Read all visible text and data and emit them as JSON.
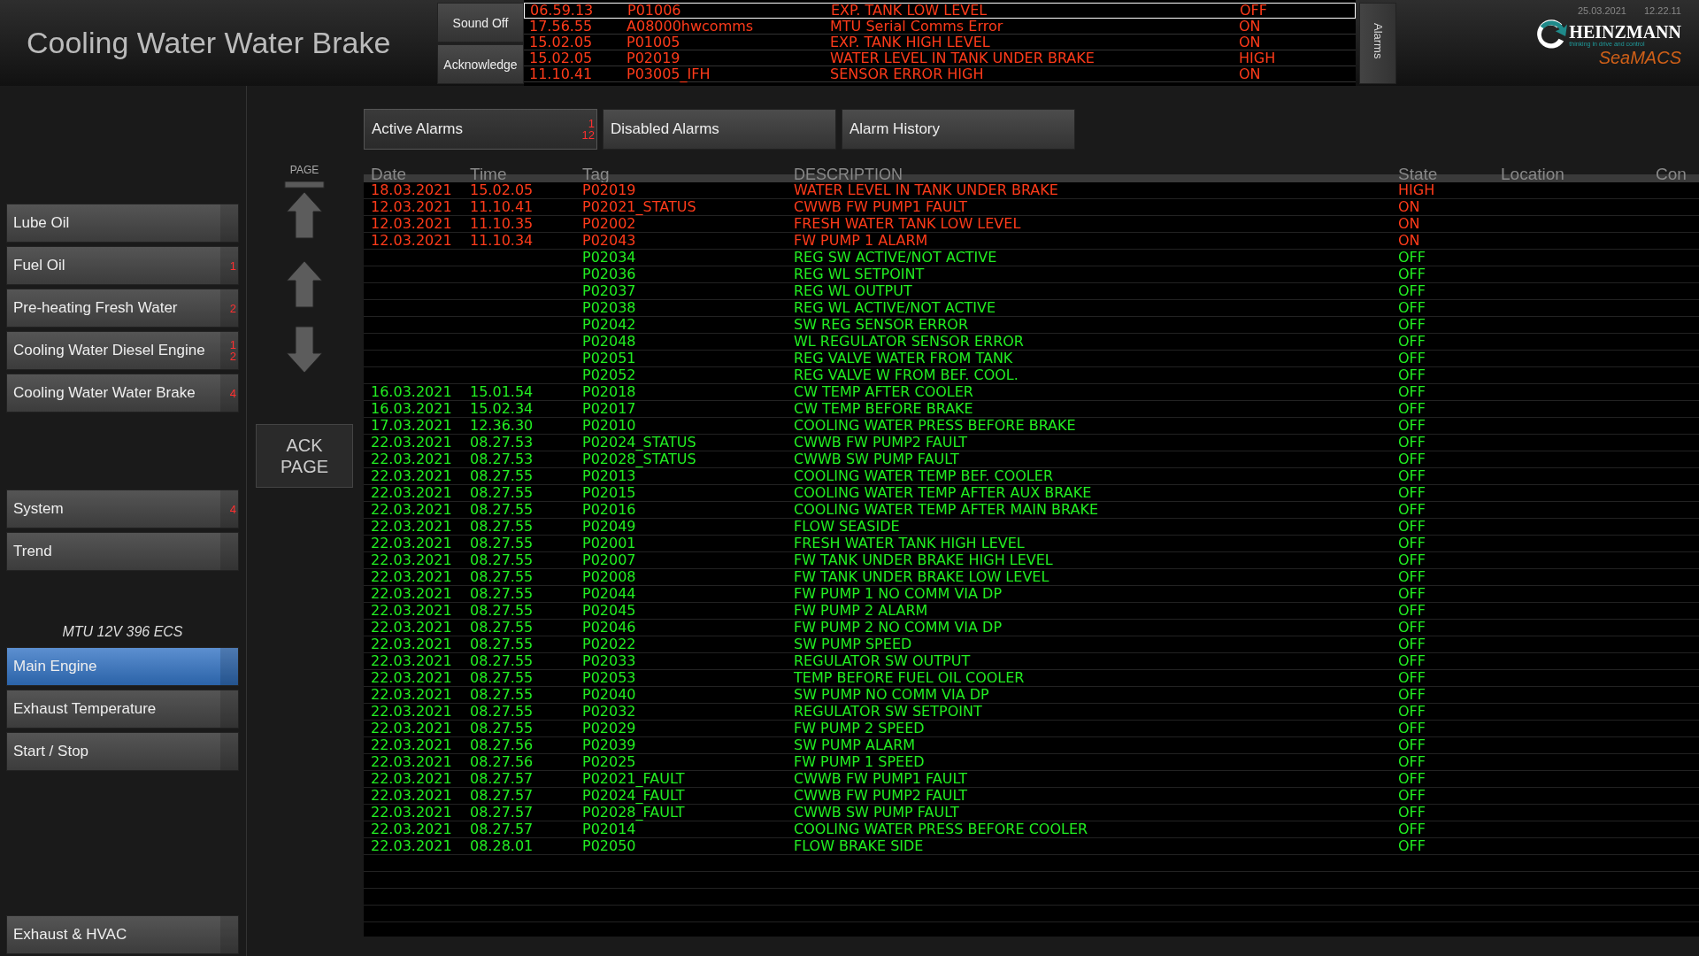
{
  "header": {
    "title": "Cooling Water Water Brake",
    "date": "25.03.2021",
    "time": "12.22.11"
  },
  "alarm_buttons": [
    "Sound Off",
    "Acknowledge"
  ],
  "alarm_banner": [
    {
      "time": "06.59.13",
      "tag": "P01006",
      "description": "EXP. TANK LOW LEVEL",
      "state": "OFF",
      "selected": true
    },
    {
      "time": "17.56.55",
      "tag": "A08000hwcomms",
      "description": "MTU Serial Comms Error",
      "state": "ON",
      "selected": false
    },
    {
      "time": "15.02.05",
      "tag": "P01005",
      "description": "EXP. TANK HIGH LEVEL",
      "state": "ON",
      "selected": false
    },
    {
      "time": "15.02.05",
      "tag": "P02019",
      "description": "WATER LEVEL IN TANK UNDER BRAKE",
      "state": "HIGH",
      "selected": false
    },
    {
      "time": "11.10.41",
      "tag": "P03005_IFH",
      "description": "SENSOR ERROR HIGH",
      "state": "ON",
      "selected": false
    }
  ],
  "alarms_tab": "Alarms",
  "logo": {
    "name": "HEINZMANN",
    "tagline": "thinking in drive and control",
    "product": "SeaMACS"
  },
  "sidebar": {
    "groups": [
      {
        "items": [
          {
            "label": "Lube Oil",
            "selected": false
          },
          {
            "label": "Fuel Oil",
            "badge": [
              "1"
            ],
            "selected": false
          },
          {
            "label": "Pre-heating Fresh Water",
            "badge": [
              "2"
            ],
            "selected": false
          },
          {
            "label": "Cooling Water Diesel Engine",
            "badge": [
              "1",
              "2"
            ],
            "selected": false
          },
          {
            "label": "Cooling Water Water Brake",
            "badge": [
              "4"
            ],
            "selected": false
          }
        ]
      },
      {
        "items": [
          {
            "label": "System",
            "badge": [
              "4"
            ],
            "selected": false
          },
          {
            "label": "Trend",
            "selected": false
          }
        ]
      },
      {
        "heading": "MTU 12V 396 ECS",
        "items": [
          {
            "label": "Main Engine",
            "selected": true
          },
          {
            "label": "Exhaust Temperature",
            "selected": false
          },
          {
            "label": "Start / Stop",
            "selected": false
          }
        ]
      },
      {
        "items": [
          {
            "label": "Exhaust & HVAC",
            "selected": false
          }
        ]
      }
    ]
  },
  "paging": {
    "label": "PAGE",
    "ack": "ACK\nPAGE"
  },
  "tabs": [
    {
      "label": "Active Alarms",
      "badge": [
        "1",
        "12"
      ],
      "selected": true
    },
    {
      "label": "Disabled Alarms",
      "selected": false
    },
    {
      "label": "Alarm History",
      "selected": false
    }
  ],
  "table": {
    "columns": [
      "Date",
      "Time",
      "Tag",
      "DESCRIPTION",
      "State",
      "Location",
      "Con"
    ],
    "rows": [
      {
        "date": "18.03.2021",
        "time": "15.02.05",
        "tag": "P02019",
        "description": "WATER LEVEL IN TANK UNDER BRAKE",
        "state": "HIGH",
        "active": true
      },
      {
        "date": "12.03.2021",
        "time": "11.10.41",
        "tag": "P02021_STATUS",
        "description": "CWWB FW PUMP1 FAULT",
        "state": "ON",
        "active": true
      },
      {
        "date": "12.03.2021",
        "time": "11.10.35",
        "tag": "P02002",
        "description": "FRESH WATER TANK LOW LEVEL",
        "state": "ON",
        "active": true
      },
      {
        "date": "12.03.2021",
        "time": "11.10.34",
        "tag": "P02043",
        "description": "FW PUMP 1 ALARM",
        "state": "ON",
        "active": true
      },
      {
        "tag": "P02034",
        "description": "REG SW ACTIVE/NOT ACTIVE",
        "state": "OFF",
        "active": false
      },
      {
        "tag": "P02036",
        "description": "REG WL SETPOINT",
        "state": "OFF",
        "active": false
      },
      {
        "tag": "P02037",
        "description": "REG WL OUTPUT",
        "state": "OFF",
        "active": false
      },
      {
        "tag": "P02038",
        "description": "REG WL ACTIVE/NOT ACTIVE",
        "state": "OFF",
        "active": false
      },
      {
        "tag": "P02042",
        "description": "SW REG SENSOR ERROR",
        "state": "OFF",
        "active": false
      },
      {
        "tag": "P02048",
        "description": "WL REGULATOR SENSOR ERROR",
        "state": "OFF",
        "active": false
      },
      {
        "tag": "P02051",
        "description": "REG VALVE WATER FROM TANK",
        "state": "OFF",
        "active": false
      },
      {
        "tag": "P02052",
        "description": "REG VALVE W FROM BEF. COOL.",
        "state": "OFF",
        "active": false
      },
      {
        "date": "16.03.2021",
        "time": "15.01.54",
        "tag": "P02018",
        "description": "CW TEMP AFTER COOLER",
        "state": "OFF",
        "active": false
      },
      {
        "date": "16.03.2021",
        "time": "15.02.34",
        "tag": "P02017",
        "description": "CW TEMP BEFORE BRAKE",
        "state": "OFF",
        "active": false
      },
      {
        "date": "17.03.2021",
        "time": "12.36.30",
        "tag": "P02010",
        "description": "COOLING WATER PRESS BEFORE BRAKE",
        "state": "OFF",
        "active": false
      },
      {
        "date": "22.03.2021",
        "time": "08.27.53",
        "tag": "P02024_STATUS",
        "description": "CWWB FW PUMP2 FAULT",
        "state": "OFF",
        "active": false
      },
      {
        "date": "22.03.2021",
        "time": "08.27.53",
        "tag": "P02028_STATUS",
        "description": "CWWB SW PUMP FAULT",
        "state": "OFF",
        "active": false
      },
      {
        "date": "22.03.2021",
        "time": "08.27.55",
        "tag": "P02013",
        "description": "COOLING WATER TEMP BEF. COOLER",
        "state": "OFF",
        "active": false
      },
      {
        "date": "22.03.2021",
        "time": "08.27.55",
        "tag": "P02015",
        "description": "COOLING WATER TEMP AFTER AUX BRAKE",
        "state": "OFF",
        "active": false
      },
      {
        "date": "22.03.2021",
        "time": "08.27.55",
        "tag": "P02016",
        "description": "COOLING WATER TEMP AFTER MAIN BRAKE",
        "state": "OFF",
        "active": false
      },
      {
        "date": "22.03.2021",
        "time": "08.27.55",
        "tag": "P02049",
        "description": "FLOW SEASIDE",
        "state": "OFF",
        "active": false
      },
      {
        "date": "22.03.2021",
        "time": "08.27.55",
        "tag": "P02001",
        "description": "FRESH WATER TANK HIGH LEVEL",
        "state": "OFF",
        "active": false
      },
      {
        "date": "22.03.2021",
        "time": "08.27.55",
        "tag": "P02007",
        "description": "FW TANK UNDER BRAKE HIGH LEVEL",
        "state": "OFF",
        "active": false
      },
      {
        "date": "22.03.2021",
        "time": "08.27.55",
        "tag": "P02008",
        "description": "FW TANK UNDER BRAKE LOW LEVEL",
        "state": "OFF",
        "active": false
      },
      {
        "date": "22.03.2021",
        "time": "08.27.55",
        "tag": "P02044",
        "description": "FW PUMP 1 NO COMM VIA DP",
        "state": "OFF",
        "active": false
      },
      {
        "date": "22.03.2021",
        "time": "08.27.55",
        "tag": "P02045",
        "description": "FW PUMP 2 ALARM",
        "state": "OFF",
        "active": false
      },
      {
        "date": "22.03.2021",
        "time": "08.27.55",
        "tag": "P02046",
        "description": "FW PUMP 2 NO COMM VIA DP",
        "state": "OFF",
        "active": false
      },
      {
        "date": "22.03.2021",
        "time": "08.27.55",
        "tag": "P02022",
        "description": "SW PUMP SPEED",
        "state": "OFF",
        "active": false
      },
      {
        "date": "22.03.2021",
        "time": "08.27.55",
        "tag": "P02033",
        "description": "REGULATOR SW OUTPUT",
        "state": "OFF",
        "active": false
      },
      {
        "date": "22.03.2021",
        "time": "08.27.55",
        "tag": "P02053",
        "description": "TEMP BEFORE FUEL OIL COOLER",
        "state": "OFF",
        "active": false
      },
      {
        "date": "22.03.2021",
        "time": "08.27.55",
        "tag": "P02040",
        "description": "SW PUMP NO COMM VIA DP",
        "state": "OFF",
        "active": false
      },
      {
        "date": "22.03.2021",
        "time": "08.27.55",
        "tag": "P02032",
        "description": "REGULATOR SW SETPOINT",
        "state": "OFF",
        "active": false
      },
      {
        "date": "22.03.2021",
        "time": "08.27.55",
        "tag": "P02029",
        "description": "FW PUMP 2 SPEED",
        "state": "OFF",
        "active": false
      },
      {
        "date": "22.03.2021",
        "time": "08.27.56",
        "tag": "P02039",
        "description": "SW PUMP ALARM",
        "state": "OFF",
        "active": false
      },
      {
        "date": "22.03.2021",
        "time": "08.27.56",
        "tag": "P02025",
        "description": "FW PUMP 1 SPEED",
        "state": "OFF",
        "active": false
      },
      {
        "date": "22.03.2021",
        "time": "08.27.57",
        "tag": "P02021_FAULT",
        "description": "CWWB FW PUMP1 FAULT",
        "state": "OFF",
        "active": false
      },
      {
        "date": "22.03.2021",
        "time": "08.27.57",
        "tag": "P02024_FAULT",
        "description": "CWWB FW PUMP2 FAULT",
        "state": "OFF",
        "active": false
      },
      {
        "date": "22.03.2021",
        "time": "08.27.57",
        "tag": "P02028_FAULT",
        "description": "CWWB SW PUMP FAULT",
        "state": "OFF",
        "active": false
      },
      {
        "date": "22.03.2021",
        "time": "08.27.57",
        "tag": "P02014",
        "description": "COOLING WATER PRESS BEFORE COOLER",
        "state": "OFF",
        "active": false
      },
      {
        "date": "22.03.2021",
        "time": "08.28.01",
        "tag": "P02050",
        "description": "FLOW BRAKE SIDE",
        "state": "OFF",
        "active": false
      }
    ]
  }
}
